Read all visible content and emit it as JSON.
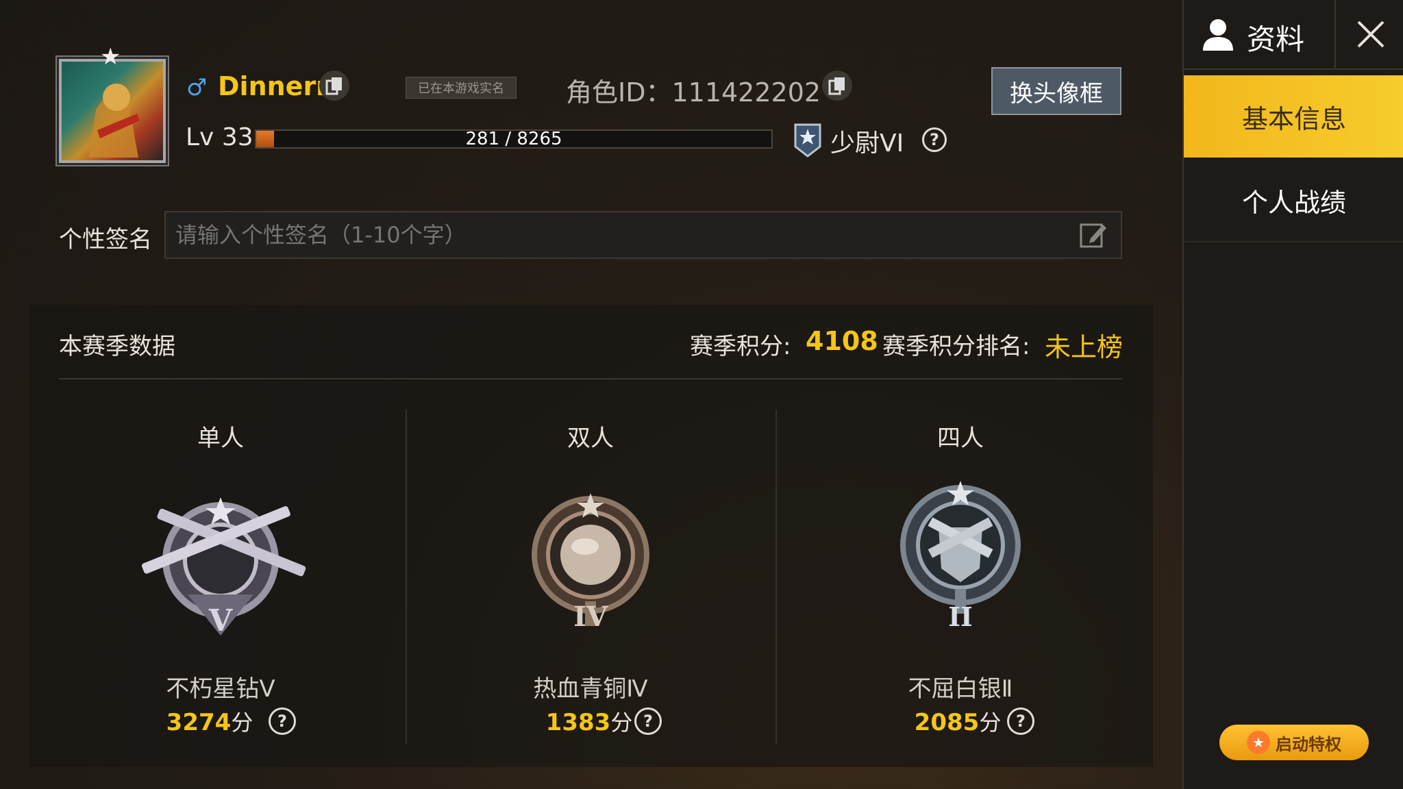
{
  "player": {
    "gender_symbol": "♂",
    "name": "Dinnerr",
    "verified_badge": "已在本游戏实名",
    "role_id_label": "角色ID：",
    "role_id": "111422202",
    "level_label": "Lv",
    "level": "33",
    "xp_text": "281 / 8265",
    "xp_progress": 0.034,
    "rank_title": "少尉VI"
  },
  "buttons": {
    "change_frame": "换头像框"
  },
  "signature": {
    "label": "个性签名",
    "placeholder": "请输入个性签名（1-10个字）"
  },
  "season": {
    "title": "本赛季数据",
    "points_label": "赛季积分:",
    "points": "4108",
    "rank_label": "赛季积分排名:",
    "rank_value": "未上榜",
    "modes": [
      {
        "title": "单人",
        "tier": "不朽星钻Ⅴ",
        "score": "3274",
        "unit": "分",
        "numeral": "V"
      },
      {
        "title": "双人",
        "tier": "热血青铜Ⅳ",
        "score": "1383",
        "unit": "分",
        "numeral": "IV"
      },
      {
        "title": "四人",
        "tier": "不屈白银Ⅱ",
        "score": "2085",
        "unit": "分",
        "numeral": "II"
      }
    ]
  },
  "sidebar": {
    "header": "资料",
    "items": [
      {
        "label": "基本信息",
        "active": true
      },
      {
        "label": "个人战绩",
        "active": false
      }
    ],
    "privilege_button": "启动特权"
  },
  "colors": {
    "accent": "#f5c518",
    "active_nav": "#f7c424",
    "gender": "#4aa3e8",
    "xp_fill": "#d8661c"
  }
}
